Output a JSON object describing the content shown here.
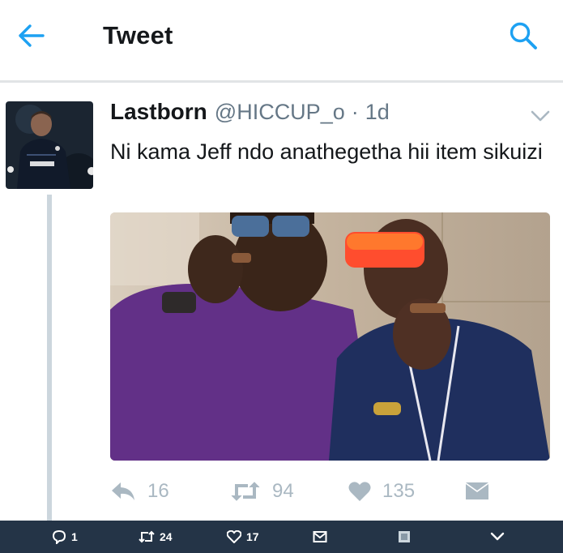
{
  "header": {
    "title": "Tweet",
    "back_icon": "back-arrow-icon",
    "search_icon": "search-icon",
    "accent": "#1da1f2"
  },
  "tweet": {
    "name": "Lastborn",
    "handle": "@HICCUP_o",
    "separator": "·",
    "time": "1d",
    "text": "Ni kama Jeff ndo anathegetha hii item sikuizi",
    "actions": {
      "reply_count": "16",
      "retweet_count": "94",
      "like_count": "135"
    }
  },
  "bottom_bar": {
    "replies": "1",
    "retweets": "24",
    "likes": "17"
  }
}
